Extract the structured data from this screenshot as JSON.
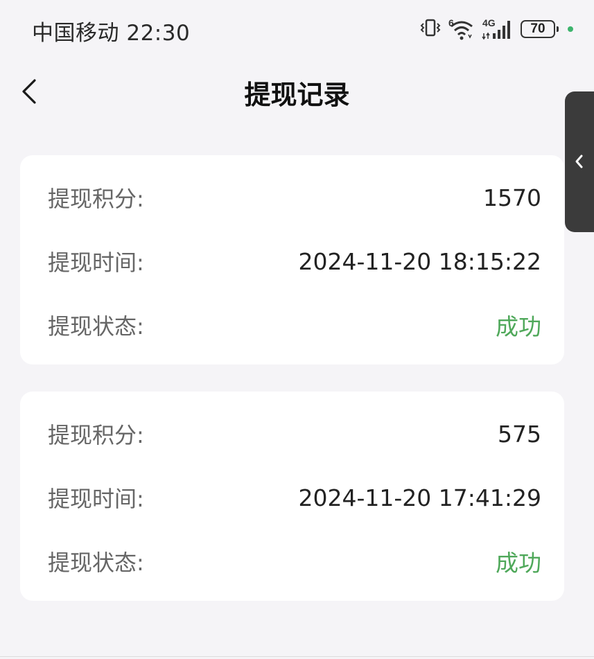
{
  "status_bar": {
    "carrier_time": "中国移动 22:30",
    "signal_label": "4G",
    "wifi_label": "6",
    "battery_level": "70",
    "icons": [
      "vibrate-icon",
      "wifi-icon",
      "cellular-signal-icon",
      "battery-icon"
    ]
  },
  "header": {
    "title": "提现记录",
    "back_icon": "chevron-left-icon"
  },
  "side_handle": {
    "icon": "chevron-left-icon"
  },
  "records": [
    {
      "points_label": "提现积分:",
      "points": "1570",
      "time_label": "提现时间:",
      "time": "2024-11-20 18:15:22",
      "status_label": "提现状态:",
      "status": "成功"
    },
    {
      "points_label": "提现积分:",
      "points": "575",
      "time_label": "提现时间:",
      "time": "2024-11-20 17:41:29",
      "status_label": "提现状态:",
      "status": "成功"
    }
  ],
  "colors": {
    "success": "#4fa85a",
    "background": "#f5f4f7",
    "card": "#ffffff"
  }
}
